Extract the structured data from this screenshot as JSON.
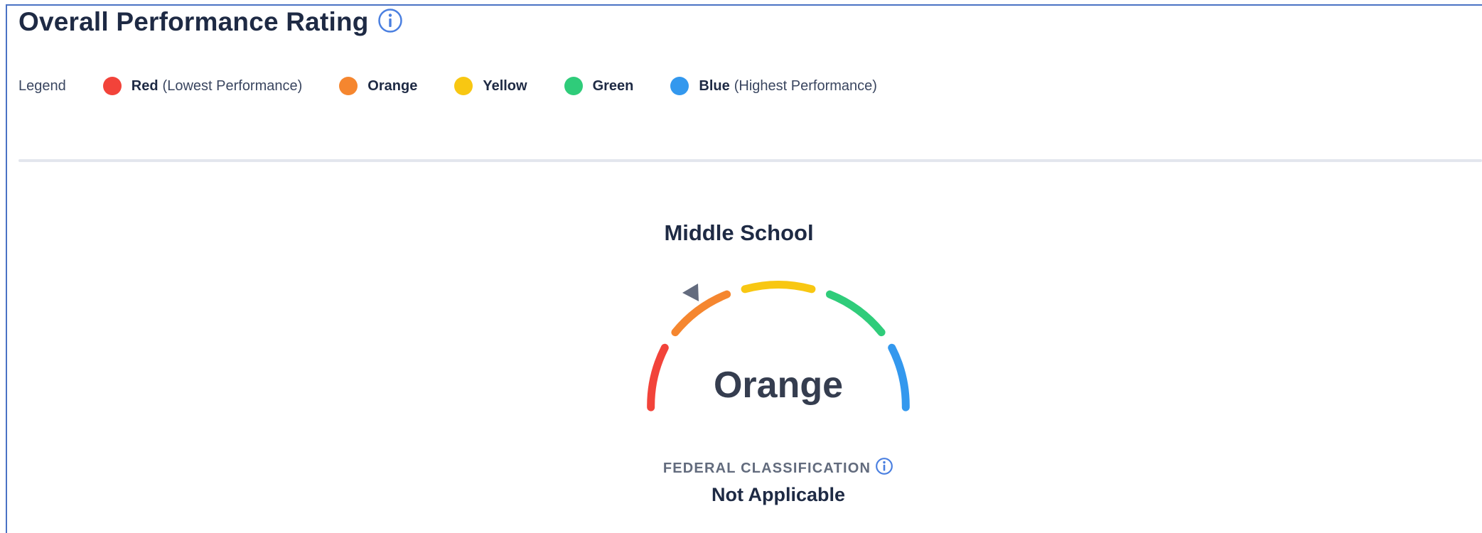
{
  "header": {
    "title": "Overall Performance Rating",
    "info_icon": "info-circle-icon"
  },
  "legend": {
    "label": "Legend",
    "items": [
      {
        "name": "Red",
        "note": "(Lowest Performance)",
        "color": "#f2433a"
      },
      {
        "name": "Orange",
        "note": "",
        "color": "#f5862f"
      },
      {
        "name": "Yellow",
        "note": "",
        "color": "#f8c712"
      },
      {
        "name": "Green",
        "note": "",
        "color": "#2fcc7a"
      },
      {
        "name": "Blue",
        "note": "(Highest Performance)",
        "color": "#3398ee"
      }
    ]
  },
  "gauge": {
    "school_level": "Middle School",
    "rating": "Orange",
    "indicator_icon": "triangle-pointer-icon",
    "indicator_color": "#636b7e"
  },
  "federal": {
    "label": "FEDERAL CLASSIFICATION",
    "info_icon": "info-circle-icon",
    "value": "Not Applicable"
  }
}
